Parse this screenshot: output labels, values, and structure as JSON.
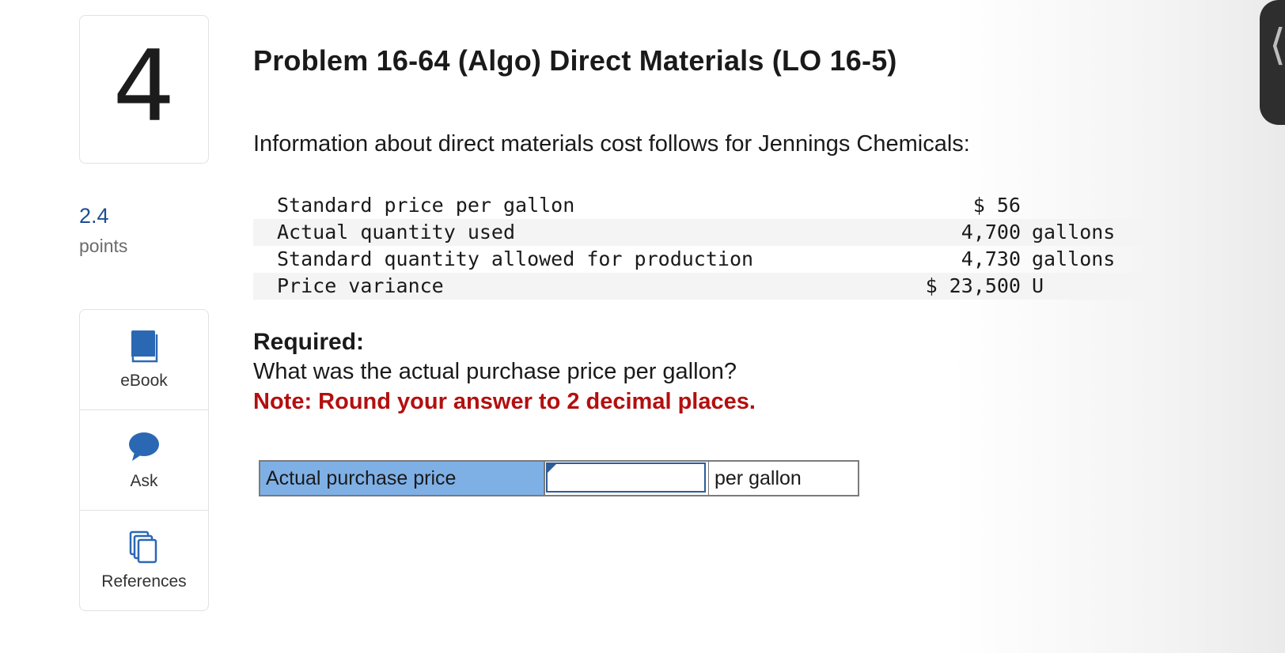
{
  "question": {
    "number": "4",
    "points_value": "2.4",
    "points_label": "points"
  },
  "tools": [
    {
      "label": "eBook",
      "icon": "book-icon"
    },
    {
      "label": "Ask",
      "icon": "speech-bubble-icon"
    },
    {
      "label": "References",
      "icon": "copy-pages-icon"
    }
  ],
  "problem": {
    "title": "Problem 16-64 (Algo) Direct Materials (LO 16-5)",
    "intro": "Information about direct materials cost follows for Jennings Chemicals:",
    "rows": [
      {
        "label": "Standard price per gallon",
        "value": "$ 56",
        "unit": ""
      },
      {
        "label": "Actual quantity used",
        "value": "4,700",
        "unit": "gallons"
      },
      {
        "label": "Standard quantity allowed for production",
        "value": "4,730",
        "unit": "gallons"
      },
      {
        "label": "Price variance",
        "value": "$ 23,500",
        "unit": "U"
      }
    ],
    "required_heading": "Required:",
    "required_question": "What was the actual purchase price per gallon?",
    "note": "Note: Round your answer to 2 decimal places."
  },
  "answer": {
    "label": "Actual purchase price",
    "input_value": "",
    "unit": "per gallon"
  },
  "colors": {
    "accent_blue": "#1d4f91",
    "answer_label_bg": "#7eb0e6",
    "note_red": "#b30f0f",
    "icon_blue": "#2b68b3"
  },
  "side_handle": {
    "icon": "chevron-left-icon",
    "glyph": "⟨"
  }
}
